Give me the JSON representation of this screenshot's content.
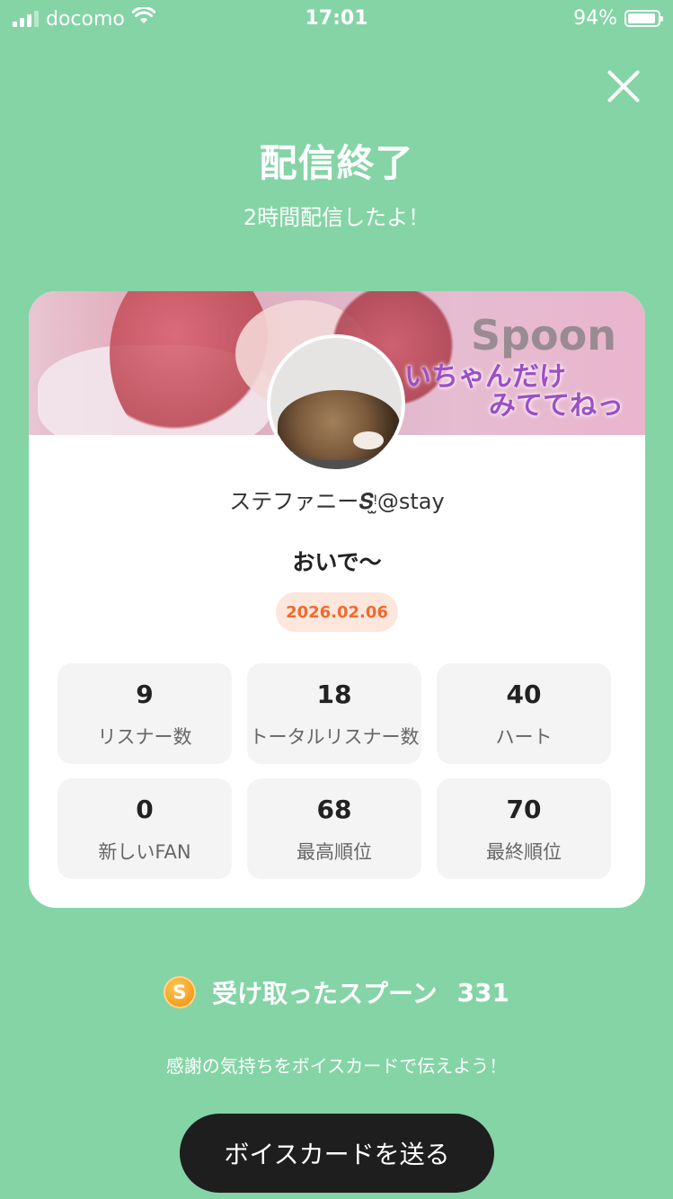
{
  "status_bar": {
    "carrier": "docomo",
    "time": "17:01",
    "battery": "94%"
  },
  "header": {
    "title": "配信終了",
    "subtitle": "2時間配信したよ！"
  },
  "card": {
    "banner": {
      "logo": "Spoon",
      "text_line1": "いちゃんだけ",
      "text_line2": "みててねっ"
    },
    "username": "ステファニー𝑺ᵎ̫@stay",
    "live_title": "おいで〜",
    "date": "2026.02.06",
    "stats": [
      {
        "value": "9",
        "label": "リスナー数"
      },
      {
        "value": "18",
        "label": "トータルリスナー数"
      },
      {
        "value": "40",
        "label": "ハート"
      },
      {
        "value": "0",
        "label": "新しいFAN"
      },
      {
        "value": "68",
        "label": "最高順位"
      },
      {
        "value": "70",
        "label": "最終順位"
      }
    ]
  },
  "spoons": {
    "icon_letter": "S",
    "label": "受け取ったスプーン",
    "count": "331"
  },
  "thanks_text": "感謝の気持ちをボイスカードで伝えよう！",
  "voice_card_button": "ボイスカードを送る",
  "colors": {
    "background": "#84d4a6",
    "date_badge_text": "#ef6b2c",
    "button_bg": "#1e1e1e"
  }
}
